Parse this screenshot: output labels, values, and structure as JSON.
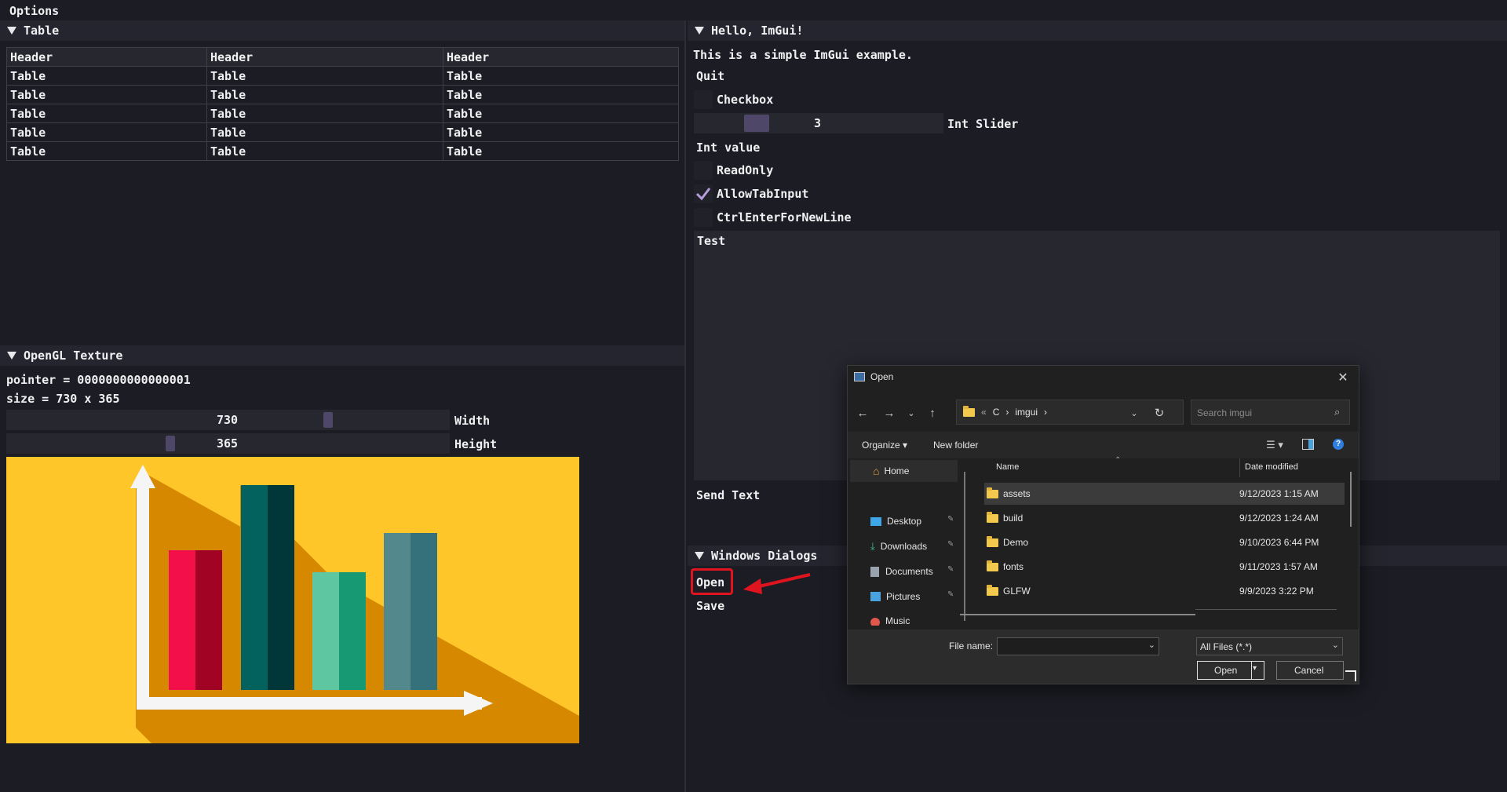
{
  "menu": {
    "title": "Options"
  },
  "table_panel": {
    "title": "Table",
    "headers": [
      "Header",
      "Header",
      "Header"
    ],
    "rows": [
      [
        "Table",
        "Table",
        "Table"
      ],
      [
        "Table",
        "Table",
        "Table"
      ],
      [
        "Table",
        "Table",
        "Table"
      ],
      [
        "Table",
        "Table",
        "Table"
      ],
      [
        "Table",
        "Table",
        "Table"
      ]
    ]
  },
  "texture_panel": {
    "title": "OpenGL Texture",
    "pointer_text": "pointer = 0000000000000001",
    "size_text": "size = 730 x 365",
    "width_value": "730",
    "width_label": "Width",
    "width_fraction": 0.73,
    "height_value": "365",
    "height_label": "Height",
    "height_fraction": 0.365
  },
  "hello_panel": {
    "title": "Hello, ImGui!",
    "intro": "This is a simple ImGui example.",
    "quit_label": "Quit",
    "checkbox_label": "Checkbox",
    "checkbox_checked": false,
    "slider_value": "3",
    "slider_label": "Int Slider",
    "int_value_label": "Int value",
    "readonly_label": "ReadOnly",
    "readonly_checked": false,
    "allowtab_label": "AllowTabInput",
    "allowtab_checked": true,
    "ctrlenter_label": "CtrlEnterForNewLine",
    "ctrlenter_checked": false,
    "textarea_value": "Test",
    "send_label": "Send Text"
  },
  "dialogs_panel": {
    "title": "Windows Dialogs",
    "open_label": "Open",
    "save_label": "Save"
  },
  "file_dialog": {
    "title": "Open",
    "breadcrumb": [
      "«",
      "C",
      "›",
      "imgui",
      "›"
    ],
    "search_placeholder": "Search imgui",
    "organize_label": "Organize ▾",
    "new_folder_label": "New folder",
    "col_name": "Name",
    "col_date": "Date modified",
    "nav_items": [
      {
        "label": "Home",
        "icon": "home-icon",
        "color": "#e8a13c"
      },
      {
        "label": "Desktop",
        "icon": "desktop-icon",
        "color": "#3fa7e8"
      },
      {
        "label": "Downloads",
        "icon": "downloads-icon",
        "color": "#3cc28a"
      },
      {
        "label": "Documents",
        "icon": "documents-icon",
        "color": "#9aa3ad"
      },
      {
        "label": "Pictures",
        "icon": "pictures-icon",
        "color": "#4aa3df"
      },
      {
        "label": "Music",
        "icon": "music-icon",
        "color": "#e2574c"
      }
    ],
    "files": [
      {
        "name": "assets",
        "date": "9/12/2023 1:15 AM"
      },
      {
        "name": "build",
        "date": "9/12/2023 1:24 AM"
      },
      {
        "name": "Demo",
        "date": "9/10/2023 6:44 PM"
      },
      {
        "name": "fonts",
        "date": "9/11/2023 1:57 AM"
      },
      {
        "name": "GLFW",
        "date": "9/9/2023 3:22 PM"
      }
    ],
    "filename_label": "File name:",
    "filename_value": "",
    "filter_value": "All Files (*.*)",
    "open_button": "Open",
    "cancel_button": "Cancel"
  },
  "colors": {
    "background": "#1c1d24",
    "header": "#24252e",
    "accent_grab": "#4e4768",
    "checkmark": "#b39ddb",
    "highlight_red": "#e0141e",
    "image_bg": "#ffc629"
  }
}
